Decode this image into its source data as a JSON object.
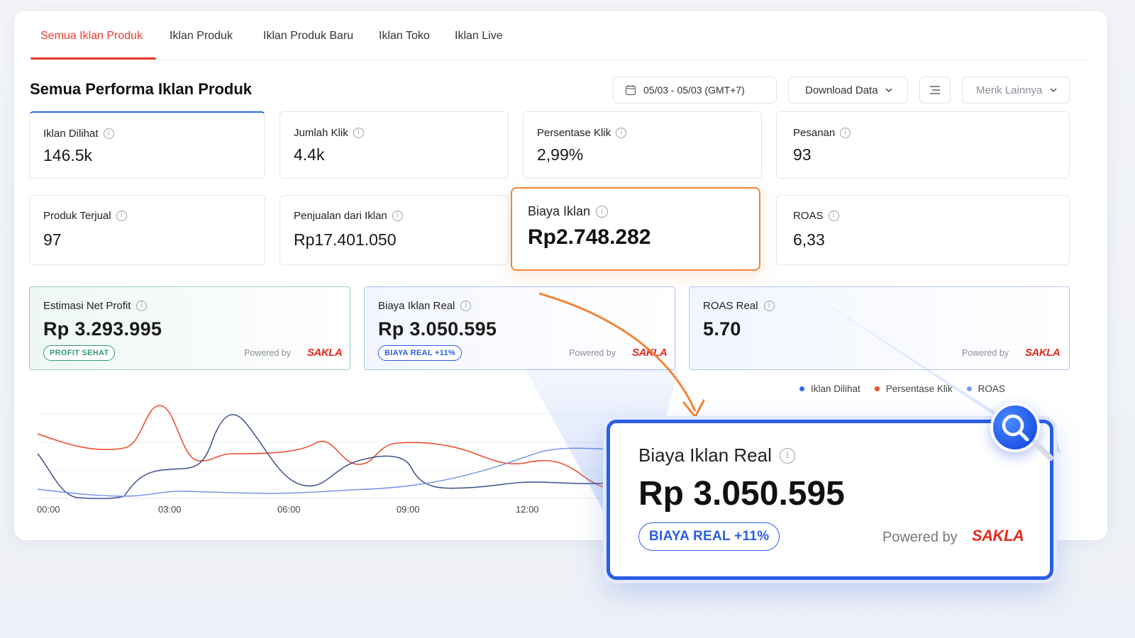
{
  "tabs": [
    {
      "label": "Semua Iklan Produk",
      "active": true
    },
    {
      "label": "Iklan Produk",
      "active": false
    },
    {
      "label": "Iklan Produk Baru",
      "active": false
    },
    {
      "label": "Iklan Toko",
      "active": false
    },
    {
      "label": "Iklan Live",
      "active": false
    }
  ],
  "section_title": "Semua Performa Iklan Produk",
  "controls": {
    "date_range": "05/03 - 05/03 (GMT+7)",
    "download_label": "Download Data",
    "more_metrics_label": "Merik Lainnya"
  },
  "metrics_row1": [
    {
      "label": "Iklan Dilihat",
      "value": "146.5k"
    },
    {
      "label": "Jumlah Klik",
      "value": "4.4k"
    },
    {
      "label": "Persentase Klik",
      "value": "2,99%"
    },
    {
      "label": "Pesanan",
      "value": "93"
    }
  ],
  "metrics_row2": [
    {
      "label": "Produk Terjual",
      "value": "97"
    },
    {
      "label": "Penjualan dari Iklan",
      "value": "Rp17.401.050"
    },
    {
      "label": "ROAS",
      "value": "6,33"
    }
  ],
  "highlight": {
    "label": "Biaya Iklan",
    "value": "Rp2.748.282"
  },
  "insight_cards": [
    {
      "label": "Estimasi Net Profit",
      "value": "Rp 3.293.995",
      "badge": "PROFIT SEHAT",
      "powered": "Powered by",
      "logo": "SAKLA"
    },
    {
      "label": "Biaya Iklan Real",
      "value": "Rp 3.050.595",
      "badge": "BIAYA REAL +11%",
      "powered": "Powered by",
      "logo": "SAKLA"
    },
    {
      "label": "ROAS Real",
      "value": "5.70",
      "powered": "Powered by",
      "logo": "SAKLA"
    }
  ],
  "zoom_card": {
    "label": "Biaya Iklan Real",
    "value": "Rp 3.050.595",
    "badge": "BIAYA REAL +11%",
    "powered": "Powered by",
    "logo": "SAKLA"
  },
  "colors": {
    "accent_red": "#ee3a2c",
    "accent_blue": "#2a5ee6",
    "highlight_orange": "#f08436",
    "profit_green": "#2f9a77"
  },
  "chart_data": {
    "type": "line",
    "x_ticks": [
      "00:00",
      "03:00",
      "06:00",
      "09:00",
      "12:00"
    ],
    "series": [
      {
        "name": "Iklan Dilihat",
        "color": "#2e6ce6"
      },
      {
        "name": "Persentase Klik",
        "color": "#ee4f2c"
      },
      {
        "name": "ROAS",
        "color": "#6e8fe8"
      }
    ]
  }
}
